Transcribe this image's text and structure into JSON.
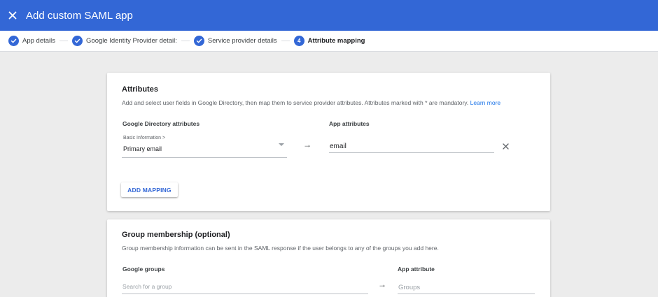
{
  "header": {
    "title": "Add custom SAML app",
    "close_icon": "close-icon"
  },
  "stepper": {
    "steps": [
      {
        "label": "App details",
        "state": "done",
        "icon": "check-icon"
      },
      {
        "label": "Google Identity Provider detail:",
        "state": "done",
        "icon": "check-icon"
      },
      {
        "label": "Service provider details",
        "state": "done",
        "icon": "check-icon"
      },
      {
        "label": "Attribute mapping",
        "state": "active",
        "number": "4"
      }
    ]
  },
  "attributes": {
    "title": "Attributes",
    "description": "Add and select user fields in Google Directory, then map them to service provider attributes. Attributes marked with * are mandatory.",
    "learn_more": "Learn more",
    "col_directory": "Google Directory attributes",
    "col_app": "App attributes",
    "mapping": {
      "category": "Basic Information >",
      "selected": "Primary email",
      "arrow": "→",
      "app_attribute_value": "email"
    },
    "add_mapping_label": "ADD MAPPING"
  },
  "group_membership": {
    "title": "Group membership (optional)",
    "description": "Group membership information can be sent in the SAML response if the user belongs to any of the groups you add here.",
    "col_groups": "Google groups",
    "col_app": "App attribute",
    "search_placeholder": "Search for a group",
    "arrow": "→",
    "app_attribute_placeholder": "Groups"
  },
  "colors": {
    "primary": "#3367d6",
    "link": "#1a73e8",
    "background": "#ececec"
  }
}
